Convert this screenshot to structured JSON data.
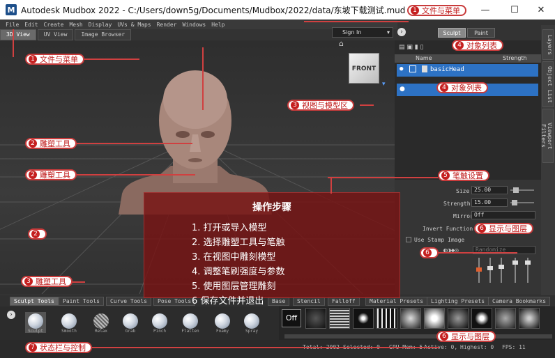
{
  "window": {
    "title": "Autodesk Mudbox 2022 - C:/Users/down5g/Documents/Mudbox/2022/data/东坡下载测试.mud",
    "app_icon": "M",
    "controls": [
      "—",
      "☐",
      "✕"
    ]
  },
  "menu": [
    "File",
    "Edit",
    "Create",
    "Mesh",
    "Display",
    "UVs & Maps",
    "Render",
    "Windows",
    "Help"
  ],
  "view_tabs": [
    "3D View",
    "UV View",
    "Image Browser"
  ],
  "sign_in": "Sign In",
  "mode_buttons": [
    "Sculpt",
    "Paint"
  ],
  "right_side_tabs": [
    "Layers",
    "Object List",
    "Viewport Filters"
  ],
  "object_list": {
    "headers": [
      "Name",
      "Strength"
    ],
    "rows": [
      "basicHead"
    ]
  },
  "view_cube": "FRONT",
  "brush": {
    "size_label": "Size",
    "size": "25.00",
    "strength_label": "Strength",
    "strength": "15.00",
    "mirror_label": "Mirror",
    "mirror": "Off",
    "invert_label": "Invert Function",
    "stamp_label": "Use Stamp Image",
    "randomize": "Randomize"
  },
  "bottom_tabs": [
    "Sculpt Tools",
    "Paint Tools",
    "Curve Tools",
    "Pose Tools",
    "Base",
    "Stencil",
    "Falloff",
    "Material Presets",
    "Lighting Presets",
    "Camera Bookmarks"
  ],
  "tools": [
    "Sculpt",
    "Smooth",
    "Relax",
    "Grab",
    "Pinch",
    "Flatten",
    "Foamy",
    "Spray"
  ],
  "stamp_off": "Off",
  "status": {
    "total": "Total: 2002",
    "selected": "Selected: 0",
    "gpu": "GPU Mem: 5",
    "active": "Active: 0,",
    "highest": "Highest: 0",
    "fps": "FPS: 11"
  },
  "annotations": {
    "a1": {
      "num": "1",
      "text": "文件与菜单"
    },
    "a1b": {
      "num": "1",
      "text": "文件与菜单"
    },
    "a2": {
      "num": "2",
      "text": "雕塑工具"
    },
    "a2b": {
      "num": "2",
      "text": "雕塑工具"
    },
    "a2c": {
      "num": "2",
      "text": ""
    },
    "a3": {
      "num": "3",
      "text": "视图与模型区"
    },
    "a3b": {
      "num": "3",
      "text": "雕塑工具"
    },
    "a4": {
      "num": "4",
      "text": "对象列表"
    },
    "a4b": {
      "num": "4",
      "text": "对象列表"
    },
    "a5": {
      "num": "5",
      "text": "笔触设置"
    },
    "a6": {
      "num": "6",
      "text": "显示与图层"
    },
    "a6b": {
      "num": "6",
      "text": ""
    },
    "a6c": {
      "num": "6",
      "text": "显示与图层"
    },
    "a7": {
      "num": "7",
      "text": "状态栏与控制"
    }
  },
  "steps": {
    "title": "操作步骤",
    "items": [
      "1. 打开或导入模型",
      "2. 选择雕塑工具与笔触",
      "3. 在视图中雕刻模型",
      "4. 调整笔刷强度与参数",
      "5. 使用图层管理雕刻",
      "6 保存文件并退出"
    ]
  },
  "colors": {
    "accent": "#c93b3b",
    "selection": "#2d72c4"
  }
}
